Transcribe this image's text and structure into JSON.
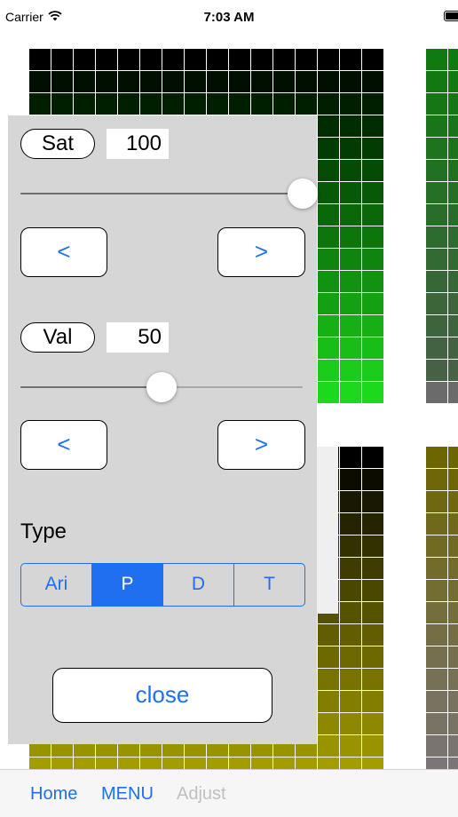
{
  "status_bar": {
    "carrier": "Carrier",
    "time": "7:03 AM"
  },
  "palette": {
    "green_block": {
      "grid_rows": 16,
      "colors": [
        "#000000",
        "#000f00",
        "#001f00",
        "#002d00",
        "#033c03",
        "#054a05",
        "#075907",
        "#0a670a",
        "#0c750c",
        "#0f840f",
        "#119211",
        "#13a013",
        "#16af16",
        "#18bd18",
        "#1bcc1b",
        "#1dd91d"
      ]
    },
    "green_gray_block": {
      "grid_rows": 16,
      "colors": [
        "#0f7a0f",
        "#127812",
        "#167616",
        "#1a741a",
        "#1e731e",
        "#227122",
        "#266f26",
        "#2a6d2a",
        "#2e6b2e",
        "#326a32",
        "#366836",
        "#3a663a",
        "#3e643e",
        "#426242",
        "#466146",
        "#6b6b6b"
      ]
    },
    "olive_block": {
      "grid_rows": 16,
      "colors": [
        "#000000",
        "#0c0c00",
        "#191800",
        "#262400",
        "#333100",
        "#3e3c00",
        "#4a4700",
        "#565300",
        "#625e00",
        "#6d6900",
        "#787300",
        "#837e00",
        "#8e8800",
        "#999300",
        "#a39d00",
        "#ada700"
      ]
    },
    "olive_gray_block": {
      "grid_rows": 16,
      "colors": [
        "#6d6500",
        "#6e6609",
        "#6f6711",
        "#70681a",
        "#716a22",
        "#726b2b",
        "#736c33",
        "#746d3c",
        "#756e44",
        "#766f4d",
        "#777055",
        "#78725e",
        "#797366",
        "#7a746f",
        "#7b7577",
        "#6d6d6d"
      ]
    }
  },
  "panel": {
    "sat": {
      "label": "Sat",
      "value": "100",
      "slider_fraction": 1.0
    },
    "val": {
      "label": "Val",
      "value": "50",
      "slider_fraction": 0.5
    },
    "prev_label": "<",
    "next_label": ">",
    "type_label": "Type",
    "type_options": [
      "Ari",
      "P",
      "D",
      "T"
    ],
    "type_selected": "P",
    "close_label": "close"
  },
  "tab_bar": {
    "home": "Home",
    "menu": "MENU",
    "adjust": "Adjust"
  },
  "colors": {
    "accent": "#1f6ff0",
    "panel_bg": "#d6d6d6",
    "disabled": "#c0c0c0"
  }
}
